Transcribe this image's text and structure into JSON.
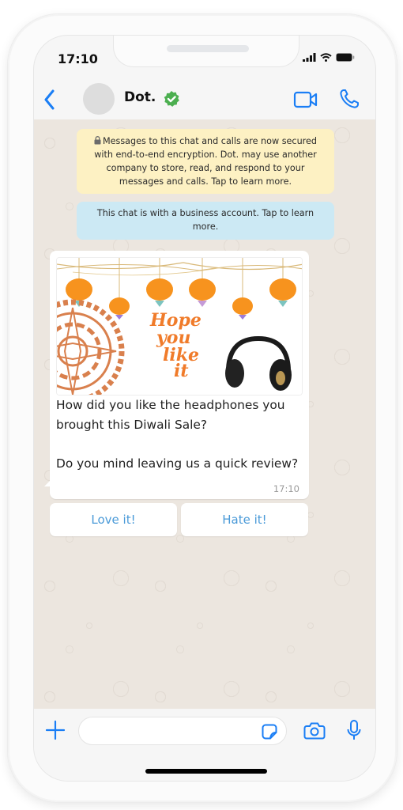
{
  "status_bar": {
    "time": "17:10"
  },
  "header": {
    "contact_name": "Dot.",
    "verified": true,
    "icons": {
      "back": "chevron-left-icon",
      "verified": "verified-badge-icon",
      "video": "video-camera-icon",
      "call": "phone-icon"
    }
  },
  "colors": {
    "accent": "#1a7ef5",
    "verified": "#4caf50",
    "encryption_bg": "#fdf1c3",
    "business_bg": "#cce9f4",
    "chat_bg": "#ece6df",
    "reply_text": "#4a9ad8"
  },
  "system_messages": {
    "encryption": "Messages to this chat and calls are now secured with end-to-end encryption. Dot. may use another company to store, read, and respond to your messages and calls. Tap to learn more.",
    "business": "This chat is with a business account. Tap to learn more."
  },
  "message": {
    "image": {
      "headline_lines": [
        "Hope",
        "you",
        "like",
        "it"
      ],
      "description": "Diwali lanterns with mandala and headphones"
    },
    "text": "How did you like the headphones you brought this Diwali Sale?\n\nDo you mind leaving us a quick review?",
    "time": "17:10"
  },
  "quick_replies": [
    {
      "label": "Love it!"
    },
    {
      "label": "Hate it!"
    }
  ],
  "composer": {
    "value": "",
    "placeholder": "",
    "icons": {
      "attach": "plus-icon",
      "sticker": "sticker-icon",
      "camera": "camera-icon",
      "mic": "microphone-icon"
    }
  }
}
